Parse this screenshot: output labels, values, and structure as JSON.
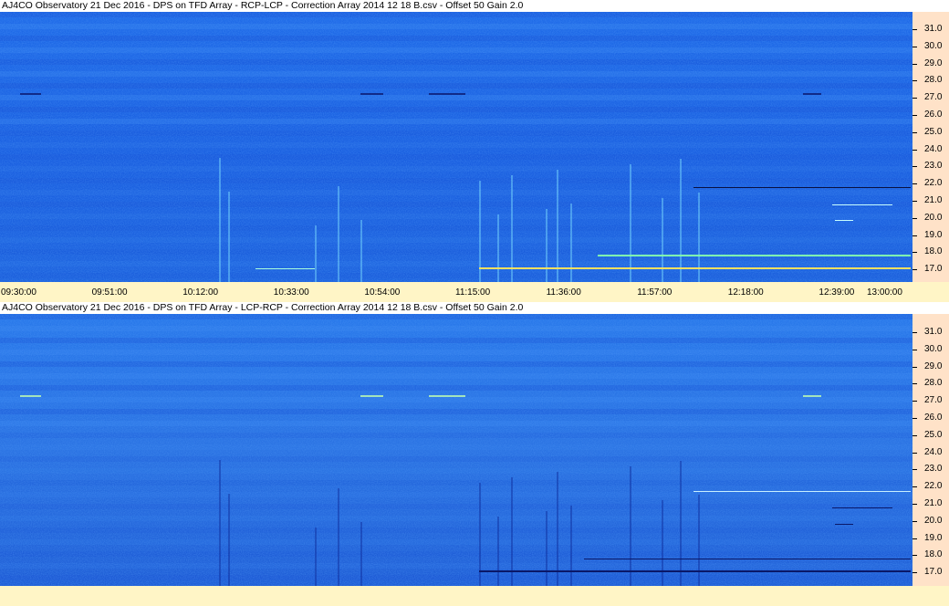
{
  "panels": [
    {
      "title": "AJ4CO Observatory 21 Dec 2016  -  DPS on TFD Array  -  RCP-LCP  -  Correction Array 2014 12 18 B.csv  -  Offset 50  Gain 2.0",
      "mode": "bright"
    },
    {
      "title": "AJ4CO Observatory 21 Dec 2016  -  DPS on TFD Array  -  LCP-RCP  -  Correction Array 2014 12 18 B.csv  -  Offset 50  Gain 2.0",
      "mode": "dark"
    }
  ],
  "frequency_labels": [
    "31.0",
    "30.0",
    "29.0",
    "28.0",
    "27.0",
    "26.0",
    "25.0",
    "24.0",
    "23.0",
    "22.0",
    "21.0",
    "20.0",
    "19.0",
    "18.0",
    "17.0"
  ],
  "time_labels": [
    "09:30:00",
    "09:51:00",
    "10:12:00",
    "10:33:00",
    "10:54:00",
    "11:15:00",
    "11:36:00",
    "11:57:00",
    "12:18:00",
    "12:39:00",
    "13:00:00"
  ],
  "colors": {
    "background_blue": "#1e64e6",
    "freq_axis_bg": "#ffe2c8",
    "time_axis_bg": "#fff5c6"
  }
}
